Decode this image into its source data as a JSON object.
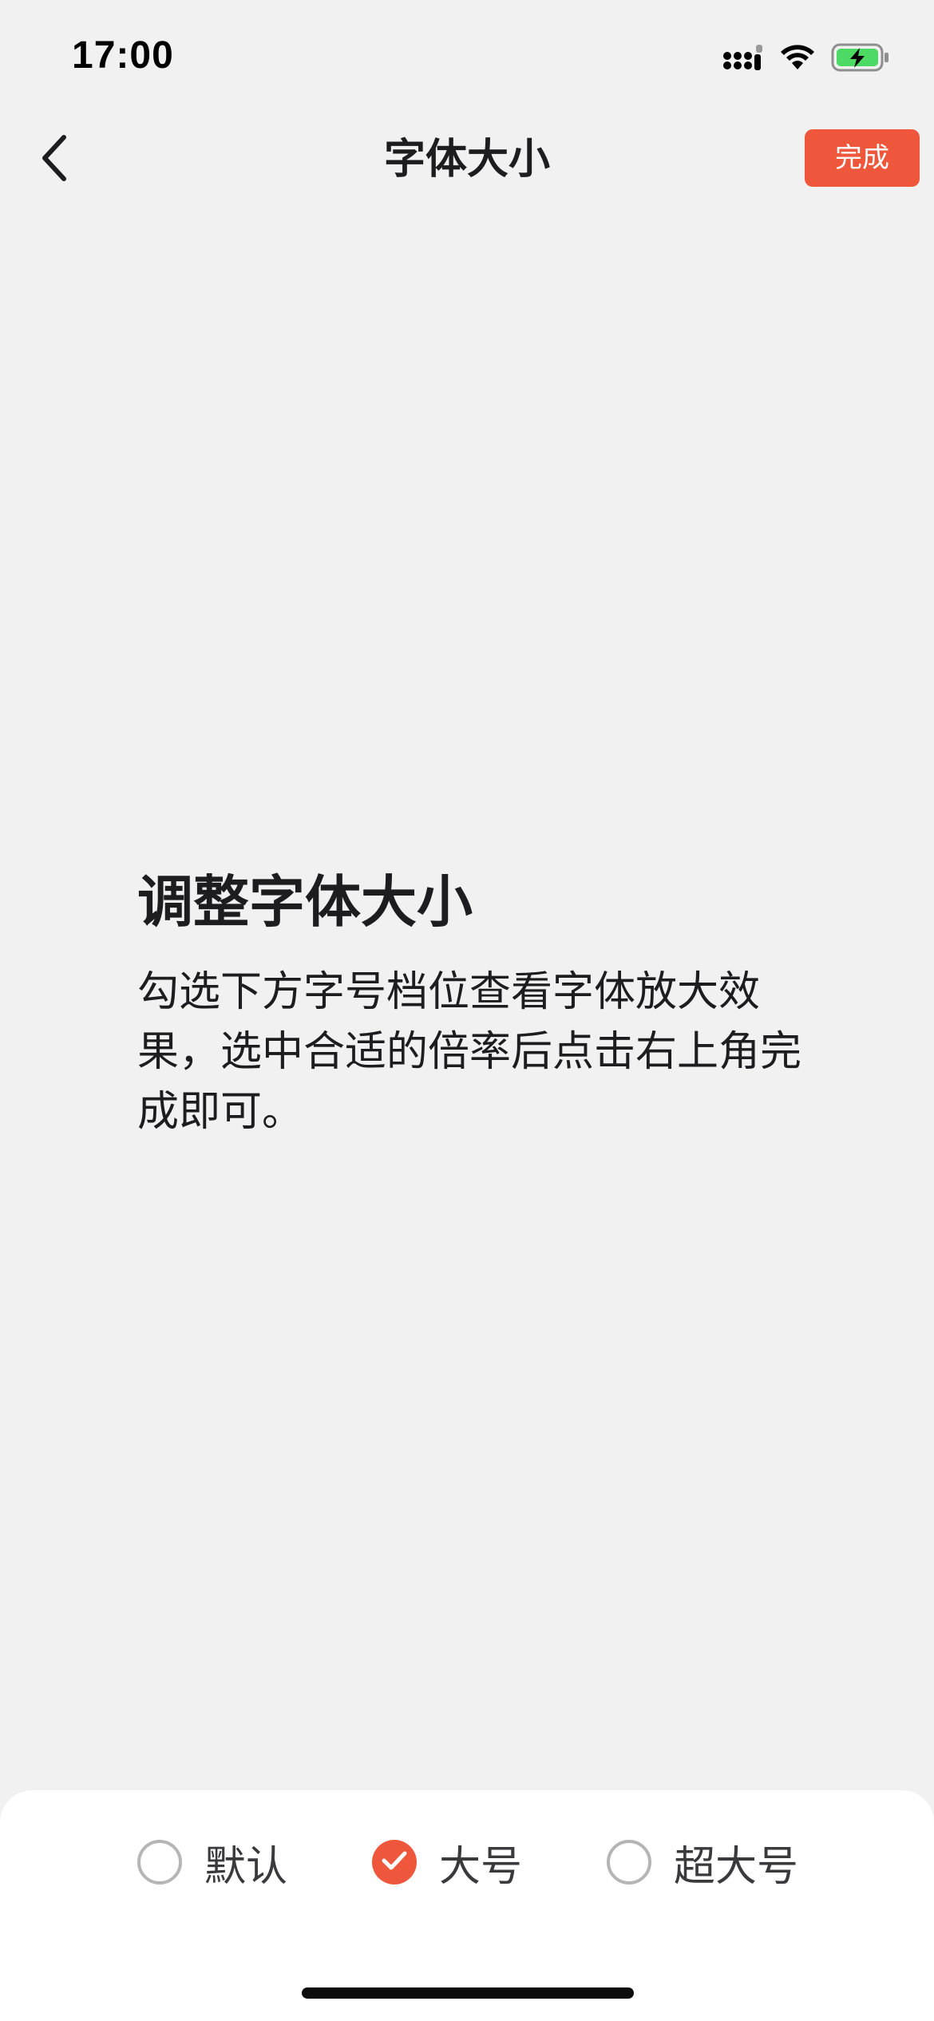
{
  "status_bar": {
    "time": "17:00",
    "icons": [
      "cellular-signal-icon",
      "wifi-icon",
      "battery-charging-icon"
    ]
  },
  "nav": {
    "title": "字体大小",
    "done_label": "完成",
    "back_icon": "chevron-left-icon"
  },
  "preview": {
    "heading": "调整字体大小",
    "body": "勾选下方字号档位查看字体放大效果，选中合适的倍率后点击右上角完成即可。"
  },
  "options": {
    "items": [
      {
        "label": "默认",
        "checked": false
      },
      {
        "label": "大号",
        "checked": true
      },
      {
        "label": "超大号",
        "checked": false
      }
    ]
  },
  "colors": {
    "accent": "#ee573c",
    "background": "#f1f1f1",
    "sheet": "#ffffff",
    "battery": "#4cd964"
  }
}
